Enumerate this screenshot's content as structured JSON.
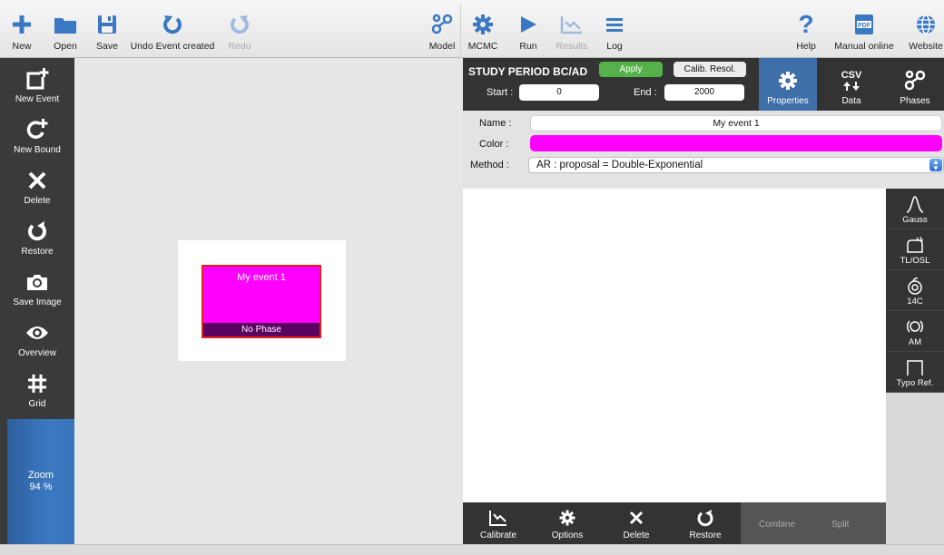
{
  "toolbar": {
    "new": "New",
    "open": "Open",
    "save": "Save",
    "undo": "Undo Event created",
    "redo": "Redo",
    "model": "Model",
    "mcmc": "MCMC",
    "run": "Run",
    "results": "Results",
    "log": "Log",
    "help": "Help",
    "manual": "Manual online",
    "website": "Website",
    "pdf_badge": "PDF"
  },
  "sidebar": {
    "new_event": "New Event",
    "new_bound": "New Bound",
    "delete": "Delete",
    "restore": "Restore",
    "save_image": "Save Image",
    "overview": "Overview",
    "grid": "Grid",
    "zoom_label": "Zoom",
    "zoom_value": "94 %"
  },
  "canvas": {
    "event_name": "My event 1",
    "event_phase": "No Phase"
  },
  "study_period": {
    "title": "STUDY PERIOD BC/AD",
    "apply": "Apply",
    "calib": "Calib. Resol.",
    "start_label": "Start :",
    "start_value": "0",
    "end_label": "End :",
    "end_value": "2000"
  },
  "right_tabs": {
    "properties": "Properties",
    "data": "Data",
    "data_csv": "CSV",
    "phases": "Phases"
  },
  "properties": {
    "name_label": "Name :",
    "name_value": "My event 1",
    "color_label": "Color :",
    "color_value": "#ff00ff",
    "method_label": "Method :",
    "method_value": "AR : proposal = Double-Exponential"
  },
  "date_types": {
    "gauss": "Gauss",
    "tlosl": "TL/OSL",
    "c14": "14C",
    "am": "AM",
    "typo": "Typo Ref."
  },
  "dates_toolbar": {
    "calibrate": "Calibrate",
    "options": "Options",
    "delete": "Delete",
    "restore": "Restore",
    "combine": "Combine",
    "split": "Split"
  },
  "colors": {
    "accent_blue": "#3f6fa8",
    "apply_green": "#55b24a",
    "event_color": "#ff00ff",
    "selection_red": "#e0201e"
  }
}
